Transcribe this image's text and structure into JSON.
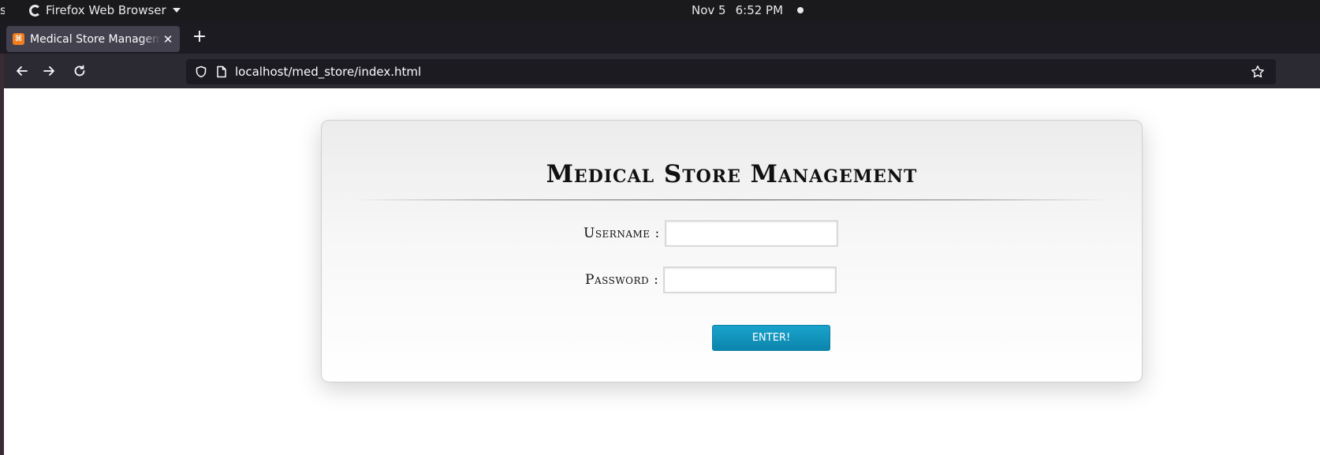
{
  "os_bar": {
    "activities_label": "s",
    "app_name": "Firefox Web Browser",
    "date": "Nov 5",
    "time": "6:52 PM"
  },
  "browser": {
    "tab_title": "Medical Store Management",
    "tab_favicon": "xampp-icon",
    "url": "localhost/med_store/index.html"
  },
  "page": {
    "title": "Medical Store Management",
    "username_label": "Username :",
    "username_value": "",
    "password_label": "Password :",
    "password_value": "",
    "enter_label": "ENTER!"
  },
  "colors": {
    "button": "#1199c2",
    "card_border": "#d0d0d0"
  }
}
